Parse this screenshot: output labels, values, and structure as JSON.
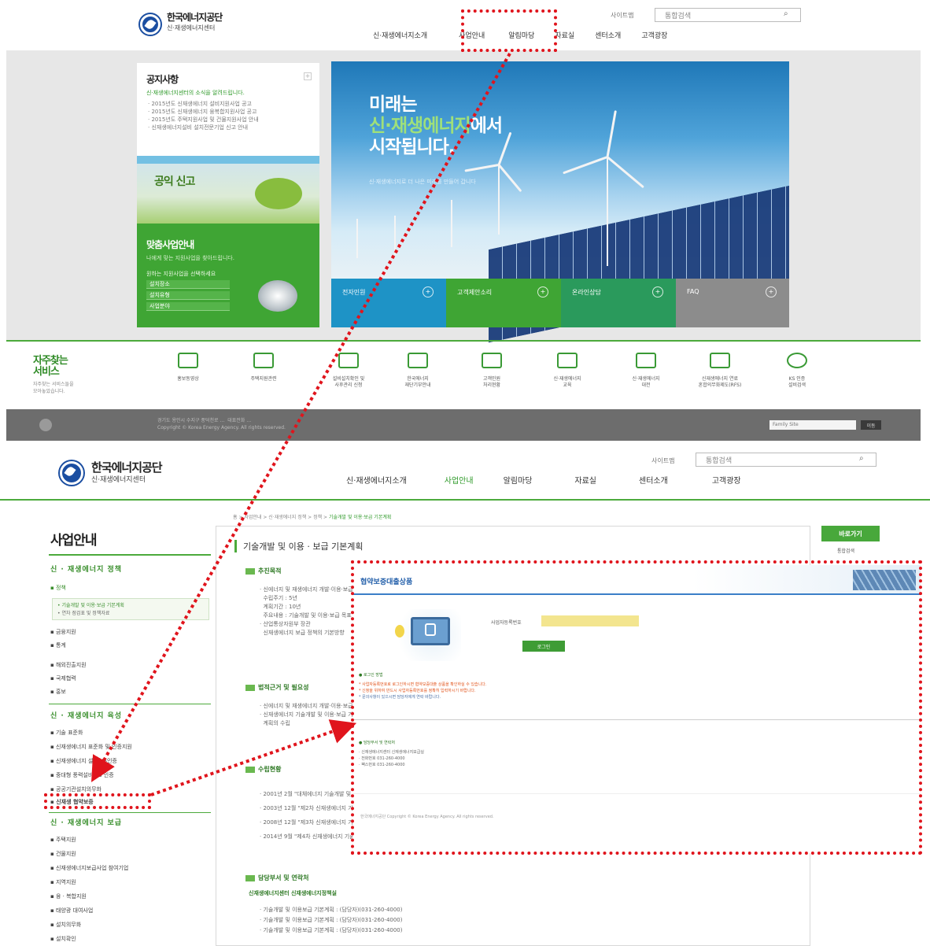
{
  "brand": {
    "name": "한국에너지공단",
    "sub": "신·재생에너지센터"
  },
  "header": {
    "sitemap": "사이트맵",
    "search_placeholder": "통합검색",
    "search_icon": "magnifier-icon"
  },
  "gnb": [
    "신·재생에너지소개",
    "사업안내",
    "알림마당",
    "자료실",
    "센터소개",
    "고객광장"
  ],
  "notice": {
    "title": "공지사항",
    "subtitle": "신·재생에너지센터의 소식을 알려드립니다.",
    "items": [
      "2015년도 신재생에너지 설비지원사업 공고",
      "2015년도 신재생에너지 융복합지원사업 공고",
      "2015년도 주택지원사업 및 건물지원사업 안내",
      "신재생에너지설비 설치전문기업 신고 안내"
    ]
  },
  "poster": {
    "title": "공익 신고"
  },
  "biz": {
    "title": "맞춤사업안내",
    "subtitle": "나에게 맞는 지원사업을 찾아드립니다.",
    "label": "원하는 지원사업을 선택하세요",
    "selects": [
      "설치장소",
      "설치유형",
      "사업분야"
    ]
  },
  "hero": {
    "line1": "미래는",
    "line2a": "신·재생에",
    "line2b": "너지",
    "line2c": "에서",
    "line3": "시작됩니다.",
    "small": "신·재생에너지로 더 나은 미래를 만들어 갑니다"
  },
  "quick_tiles": [
    {
      "label": "전자민원",
      "color": "#1e93c6"
    },
    {
      "label": "고객제안소리",
      "color": "#3fa534"
    },
    {
      "label": "온라인상담",
      "color": "#2a9a5c"
    },
    {
      "label": "FAQ",
      "color": "#8c8c8c"
    }
  ],
  "services": {
    "title": "자주찾는\n서비스",
    "subtitle": "자주찾는 서비스들을\n모아놓았습니다.",
    "items": [
      {
        "label": "홍보동영상",
        "icon": "video-icon"
      },
      {
        "label": "주택지원관련",
        "icon": "calendar-icon"
      },
      {
        "label": "설비설치확인 및\n사후관리 신청",
        "icon": "folder-icon"
      },
      {
        "label": "한국에너지\n재단기부안내",
        "icon": "chart-icon"
      },
      {
        "label": "고객민원\n처리현황",
        "icon": "download-icon"
      },
      {
        "label": "신·재생에너지\n교육",
        "icon": "people-icon"
      },
      {
        "label": "신·재생에너지\n대전",
        "icon": "cart-icon"
      },
      {
        "label": "신재생에너지 연료\n혼합의무화제도(RFS)",
        "icon": "printer-icon"
      },
      {
        "label": "KS 인증\n설비검색",
        "icon": "globe-icon"
      }
    ]
  },
  "footer": {
    "text": "경기도 용인시 수지구 풍덕천로 …  대표전화 …\nCopyright © Korea Energy Agency. All rights reserved.",
    "family": "Family Site",
    "go": "이동"
  },
  "sub": {
    "section_title": "사업안내",
    "breadcrumb": "홈 > 사업안내 > 신·재생에너지 정책 > 정책 > ",
    "breadcrumb_current": "기술개발 및 이용·보급 기본계획",
    "page_title": "기술개발 및 이용 · 보급 기본계획",
    "quick_btn": "바로가기",
    "quick_sub": "통합검색",
    "lnb": {
      "sec1": "신 · 재생에너지 정책",
      "sec1_items": [
        "정책"
      ],
      "sec1_box": [
        "기술개발 및 이용·보급 기본계획",
        "연차 점검표 및 정책자료"
      ],
      "sec1_more": [
        "금융지원",
        "통계",
        "해외진출지원",
        "국제협력",
        "홍보"
      ],
      "sec2": "신 · 재생에너지 육성",
      "sec2_items": [
        "기술 표준화",
        "신재생에너지 표준화 및 인증지원",
        "신재생에너지 설비 KS인증",
        "중대형 풍력설비 KS 인증",
        "공공기관설치의무화",
        "신재생 협약보증"
      ],
      "sec3": "신 · 재생에너지 보급",
      "sec3_items": [
        "주택지원",
        "건물지원",
        "신재생에너지보급사업 참여기업",
        "지역지원",
        "융 · 복합지원",
        "태양광 대여사업",
        "설치의무화",
        "설치확인"
      ]
    },
    "sections": [
      "추진목적",
      "법적근거 및 필요성",
      "수립현황",
      "담당부서 및 연락처"
    ],
    "purpose_lines": [
      "· 신에너지 및 재생에너지 개발·이용·보급 촉진법",
      "  수립주기 : 5년",
      "  계획기간 : 10년",
      "  주요내용 : 기술개발 및 이용·보급 목표",
      "· 산업통상자원부 장관",
      "  신재생에너지 보급 정책의 기본방향"
    ],
    "basis_lines": [
      "· 신에너지 및 재생에너지 개발·이용·보급 촉진법",
      "· 신재생에너지 기술개발 및 이용·보급 기본계획",
      "  계획의 수립"
    ],
    "status_lines": [
      "· 2001년 2월 \"대체에너지 기술개발 및 보급 기본계획\"",
      "· 2003년 12월 \"제2차 신재생에너지 기술개발 및 이용·보급 기본계획\"",
      "· 2008년 12월 \"제3차 신재생에너지 기술개발 및 이용·보급 기본계획\"",
      "· 2014년 9월 \"제4차 신재생에너지 기술개발 및 이용·보급 기본계획 (2014~2035)\""
    ],
    "contact_title": "신재생에너지센터 신재생에너지정책실",
    "contact_lines": [
      "· 기술개발 및 이용보급 기본계획 : (담당자)(031-260-4000)",
      "· 기술개발 및 이용보급 기본계획 : (담당자)(031-260-4000)",
      "· 기술개발 및 이용보급 기본계획 : (담당자)(031-260-4000)"
    ]
  },
  "popup": {
    "title": "협약보증대출상품",
    "field_label": "사업자등록번호",
    "login": "로그인",
    "note_title": "로그인 방법",
    "notes": [
      "사업자등록번호로 로그인하시면 협약보증대출 상품을 확인하실 수 있습니다.",
      "신청을 위하여 반드시 사업자등록번호를 정확히 입력하시기 바랍니다.",
      "문의사항이 있으시면 담당자에게 연락 바랍니다."
    ],
    "contact_title": "담당부서 및 연락처",
    "contacts": [
      "신재생에너지센터 신재생에너지보급실",
      "전화번호 031-260-4000",
      "팩스번호 031-260-4000"
    ],
    "footer": "한국에너지공단  Copyright © Korea Energy Agency. All rights reserved."
  },
  "colors": {
    "accent_green": "#3fa534",
    "brand_blue": "#1b4ea1",
    "callout_red": "#e0141c"
  }
}
